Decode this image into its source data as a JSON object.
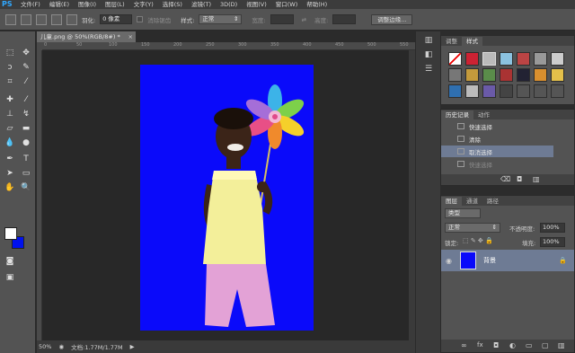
{
  "app": {
    "logo": "PS"
  },
  "menu": [
    "文件(F)",
    "编辑(E)",
    "图像(I)",
    "图层(L)",
    "文字(Y)",
    "选择(S)",
    "滤镜(T)",
    "3D(D)",
    "视图(V)",
    "窗口(W)",
    "帮助(H)"
  ],
  "options": {
    "feather_label": "羽化:",
    "feather_value": "0 像素",
    "antialias_label": "消除锯齿",
    "style_label": "样式:",
    "style_value": "正常",
    "width_label": "宽度:",
    "height_label": "高度:",
    "refine_edge_button": "调整边缘..."
  },
  "document": {
    "tab_title": "儿童.png @ 50%(RGB/8#) *",
    "tab_close": "×",
    "ruler_ticks": [
      "0",
      "50",
      "100",
      "150",
      "200",
      "250",
      "300",
      "350",
      "400",
      "450",
      "500",
      "550"
    ]
  },
  "status": {
    "zoom": "50%",
    "doc_info": "文档:1.77M/1.77M",
    "arrow": "▶"
  },
  "panels": {
    "styles_tabs": [
      "调整",
      "样式"
    ],
    "history_tabs": [
      "历史记录",
      "动作"
    ],
    "history_items": [
      "快速选择",
      "清除",
      "取消选择",
      "快速选择"
    ],
    "layers_tabs": [
      "图层",
      "通道",
      "路径"
    ],
    "kind_select": "类型",
    "blend_mode": "正常",
    "opacity_label": "不透明度:",
    "opacity_value": "100%",
    "lock_label": "锁定:",
    "fill_label": "填充:",
    "fill_value": "100%",
    "layer_name": "背景"
  },
  "colors": {
    "canvas_bg": "#0a0afa",
    "background_swatch": "#0011ee",
    "foreground_swatch": "#ffffff"
  }
}
